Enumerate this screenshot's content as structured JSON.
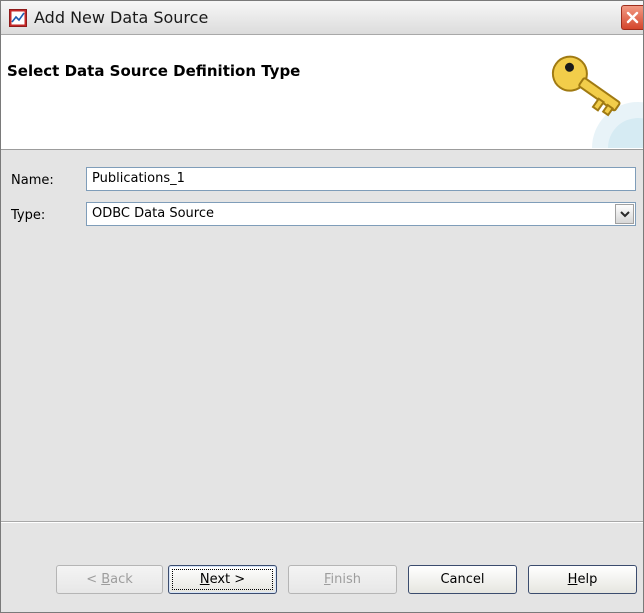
{
  "window": {
    "title": "Add New Data Source",
    "close_label": "×"
  },
  "header": {
    "title": "Select Data Source Definition Type",
    "icon": "key-icon"
  },
  "form": {
    "name_label": "Name:",
    "name_value": "Publications_1",
    "type_label": "Type:",
    "type_value": "ODBC Data Source"
  },
  "buttons": {
    "back": {
      "prefix": "< ",
      "mnemonic": "B",
      "rest": "ack",
      "enabled": false
    },
    "next": {
      "prefix": "",
      "mnemonic": "N",
      "rest": "ext >",
      "enabled": true
    },
    "finish": {
      "prefix": "",
      "mnemonic": "F",
      "rest": "inish",
      "enabled": false
    },
    "cancel": {
      "label": "Cancel",
      "enabled": true
    },
    "help": {
      "prefix": "",
      "mnemonic": "H",
      "rest": "elp",
      "enabled": true
    }
  }
}
